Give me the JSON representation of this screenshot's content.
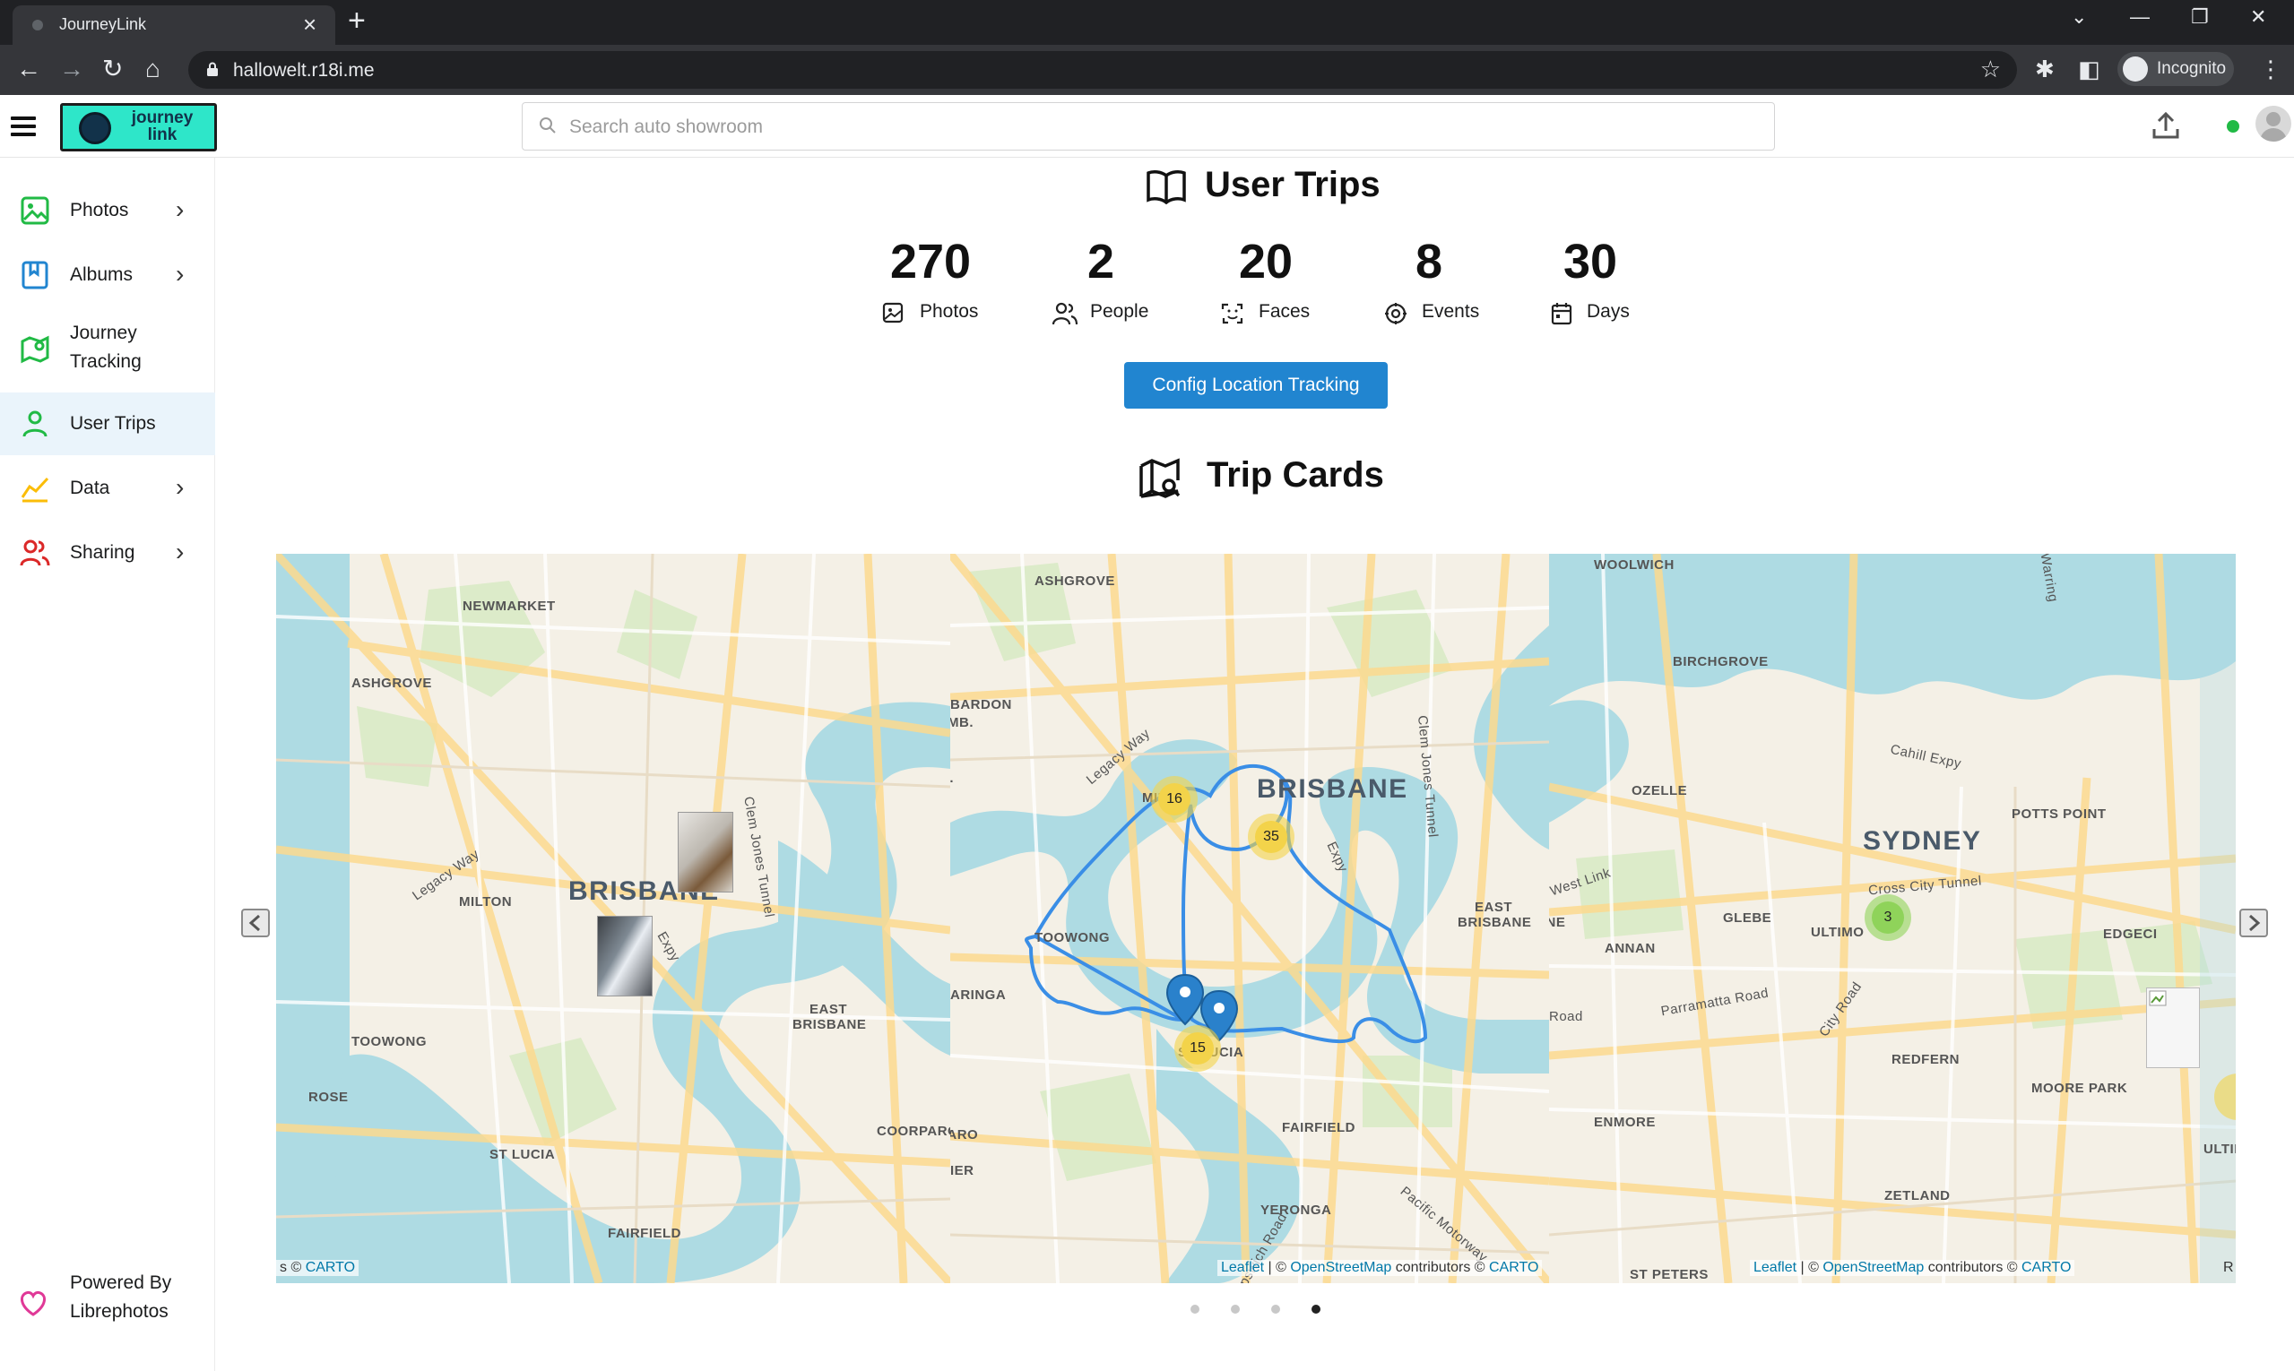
{
  "browser": {
    "tab_title": "JourneyLink",
    "url": "hallowelt.r18i.me",
    "incognito_label": "Incognito"
  },
  "header": {
    "logo_line1": "journey",
    "logo_line2": "link",
    "search_placeholder": "Search auto showroom",
    "status_color": "#21ba45"
  },
  "sidebar": {
    "items": [
      {
        "label": "Photos",
        "icon": "photo-icon",
        "color": "#21ba45",
        "has_submenu": true
      },
      {
        "label": "Albums",
        "icon": "album-icon",
        "color": "#2185d0",
        "has_submenu": true
      },
      {
        "label": "Journey Tracking",
        "icon": "map-marker-icon",
        "color": "#21ba45",
        "has_submenu": false
      },
      {
        "label": "User Trips",
        "icon": "user-icon",
        "color": "#21ba45",
        "has_submenu": false,
        "active": true
      },
      {
        "label": "Data",
        "icon": "chart-area-icon",
        "color": "#fbbd08",
        "has_submenu": true
      },
      {
        "label": "Sharing",
        "icon": "users-icon",
        "color": "#db2828",
        "has_submenu": true
      }
    ],
    "powered_by": "Powered By Librephotos",
    "powered_icon": "heart-icon"
  },
  "main": {
    "title": "User Trips",
    "stats": [
      {
        "value": "270",
        "label": "Photos",
        "icon": "image-icon"
      },
      {
        "value": "2",
        "label": "People",
        "icon": "people-icon"
      },
      {
        "value": "20",
        "label": "Faces",
        "icon": "face-scan-icon"
      },
      {
        "value": "8",
        "label": "Events",
        "icon": "events-icon"
      },
      {
        "value": "30",
        "label": "Days",
        "icon": "calendar-icon"
      }
    ],
    "config_button": "Config Location Tracking",
    "trip_cards_title": "Trip Cards"
  },
  "map": {
    "panel1": {
      "city": "BRISBANE",
      "places": [
        "NEWMARKET",
        "ASHGROVE",
        "MILTON",
        "TOOWONG",
        "ROSE",
        "ST LUCIA",
        "FAIRFIELD",
        "EAST BRISBANE",
        "COORPARO",
        "Legacy Way",
        "Clem Jones Tunnel",
        "Expy"
      ],
      "attribution_prefix": "s © ",
      "attribution_link": "CARTO"
    },
    "panel2": {
      "city": "BRISBANE",
      "places": [
        "ASHGROVE",
        "BARDON",
        "BULIMB.",
        "B.",
        "MIL",
        "TOOWONG",
        "ARINGA",
        "ST LUCIA",
        "EAST BRISBANE",
        "FAIRFIELD",
        "YERONGA",
        "IER",
        "COORPARO",
        "Legacy Way",
        "Clem Jones Tunnel",
        "Expy",
        "Pacific Motorway",
        "Ipswich Road"
      ],
      "clusters": [
        "16",
        "35",
        "15"
      ],
      "attribution_leaflet": "Leaflet",
      "attribution_mid": " | © ",
      "attribution_osm": "OpenStreetMap",
      "attribution_contrib": " contributors © ",
      "attribution_carto": "CARTO"
    },
    "panel3": {
      "city": "SYDNEY",
      "places": [
        "WOOLWICH",
        "BIRCHGROVE",
        "OZELLE",
        "POTTS POINT",
        "EAST BRISBANE",
        "GLEBE",
        "ULTIMO",
        "ANNAN",
        "EDGECI",
        "REDFERN",
        "MOORE PARK",
        "ENMORE",
        "ZETLAND",
        "ST PETERS",
        "ULTIMO",
        "Cahill Expy",
        "Cross City Tunnel",
        "West Link",
        "Parramatta Road",
        "City Road",
        "Road",
        "Warring"
      ],
      "clusters": [
        "3"
      ],
      "attribution_leaflet": "Leaflet",
      "attribution_mid": " | © ",
      "attribution_osm": "OpenStreetMap",
      "attribution_contrib": " contributors © ",
      "attribution_carto": "CARTO",
      "right_edge": "R"
    },
    "colors": {
      "water": "#aedbe3",
      "land": "#f4f0e6",
      "park": "#dcebc9",
      "road": "#fbd98e",
      "route": "#3a8ee6",
      "cluster_yellow": "#f3d34a",
      "cluster_green": "#8fd35a"
    },
    "carousel": {
      "dots": 4,
      "active_dot": 4
    }
  }
}
